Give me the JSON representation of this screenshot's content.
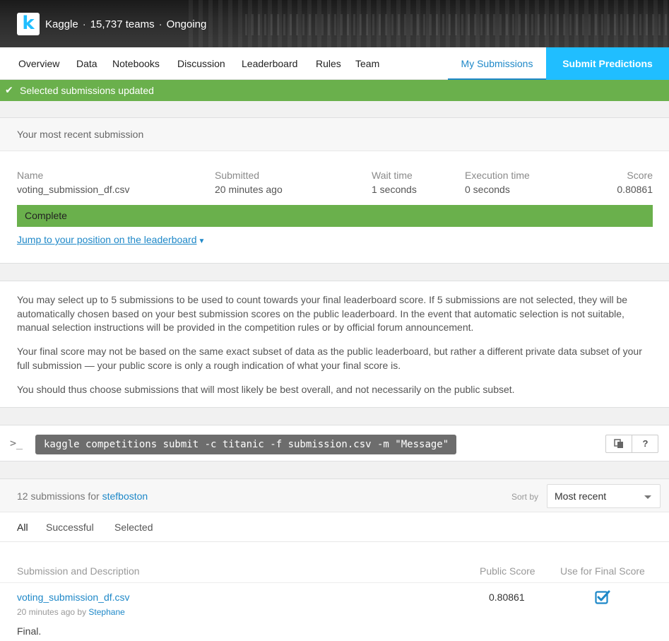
{
  "header": {
    "logo_letter": "k",
    "app_name": "Kaggle",
    "teams": "15,737 teams",
    "status": "Ongoing"
  },
  "nav": {
    "items": [
      "Overview",
      "Data",
      "Notebooks",
      "Discussion",
      "Leaderboard",
      "Rules",
      "Team"
    ],
    "my_submissions": "My Submissions",
    "submit": "Submit Predictions"
  },
  "notice": {
    "text": "Selected submissions updated",
    "color": "#6ab04c"
  },
  "recent": {
    "title": "Your most recent submission",
    "labels": {
      "name": "Name",
      "submitted": "Submitted",
      "wait": "Wait time",
      "exec": "Execution time",
      "score": "Score"
    },
    "values": {
      "name": "voting_submission_df.csv",
      "submitted": "20 minutes ago",
      "wait": "1 seconds",
      "exec": "0 seconds",
      "score": "0.80861"
    },
    "status": "Complete",
    "jump_link": "Jump to your position on the leaderboard"
  },
  "info": {
    "p1": "You may select up to 5 submissions to be used to count towards your final leaderboard score. If 5 submissions are not selected, they will be automatically chosen based on your best submission scores on the public leaderboard. In the event that automatic selection is not suitable, manual selection instructions will be provided in the competition rules or by official forum announcement.",
    "p2": "Your final score may not be based on the same exact subset of data as the public leaderboard, but rather a different private data subset of your full submission — your public score is only a rough indication of what your final score is.",
    "p3": "You should thus choose submissions that will most likely be best overall, and not necessarily on the public subset."
  },
  "command": {
    "prompt": ">_",
    "text": "kaggle competitions submit -c titanic -f submission.csv -m \"Message\"",
    "help": "?"
  },
  "list": {
    "count_prefix": "12 submissions for",
    "user": "stefboston",
    "sort_label": "Sort by",
    "sort_value": "Most recent",
    "filters": [
      "All",
      "Successful",
      "Selected"
    ],
    "columns": {
      "description": "Submission and Description",
      "public": "Public Score",
      "final": "Use for Final Score"
    },
    "rows": [
      {
        "file": "voting_submission_df.csv",
        "meta_prefix": "20 minutes ago by",
        "author": "Stephane",
        "score": "0.80861",
        "selected": true,
        "description": "Final."
      }
    ]
  }
}
